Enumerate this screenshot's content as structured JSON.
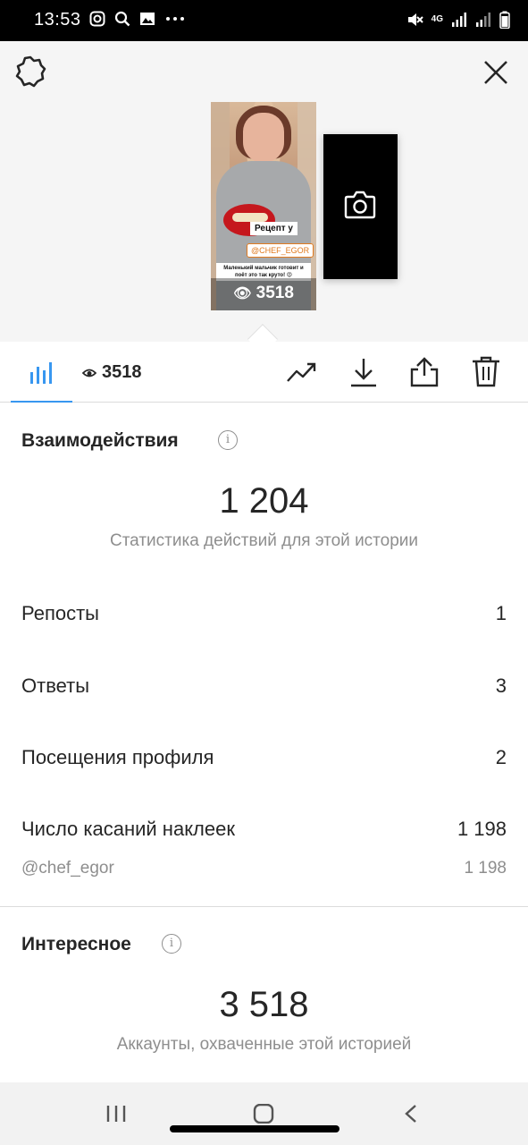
{
  "status_bar": {
    "time": "13:53",
    "left_icons": [
      "instagram-icon",
      "search-icon",
      "gallery-icon",
      "more-dots-icon"
    ],
    "right_icons": [
      "mute-icon",
      "4g-icon",
      "signal-icon",
      "signal-icon",
      "battery-icon"
    ],
    "network_label": "4G"
  },
  "preview": {
    "thumbnail_views": "3518",
    "sticker_title": "Рецепт у",
    "sticker_mention": "@CHEF_EGOR",
    "sticker_caption": "Маленький мальчик готовит и поёт это так круто! 😍",
    "new_story_icon": "camera-icon"
  },
  "toolbar": {
    "views": "3518",
    "actions": [
      "insights-icon",
      "promote-icon",
      "download-icon",
      "share-icon",
      "delete-icon"
    ]
  },
  "interactions": {
    "title": "Взаимодействия",
    "total": "1 204",
    "subtitle": "Статистика действий для этой истории",
    "rows": [
      {
        "label": "Репосты",
        "value": "1"
      },
      {
        "label": "Ответы",
        "value": "3"
      },
      {
        "label": "Посещения профиля",
        "value": "2"
      },
      {
        "label": "Число касаний наклеек",
        "value": "1 198"
      }
    ],
    "sub_row": {
      "label": "@chef_egor",
      "value": "1 198"
    }
  },
  "discovery": {
    "title": "Интересное",
    "total": "3 518",
    "subtitle": "Аккаунты, охваченные этой историей"
  },
  "colors": {
    "accent": "#3897f0",
    "text": "#262626",
    "muted": "#8e8e8e"
  }
}
